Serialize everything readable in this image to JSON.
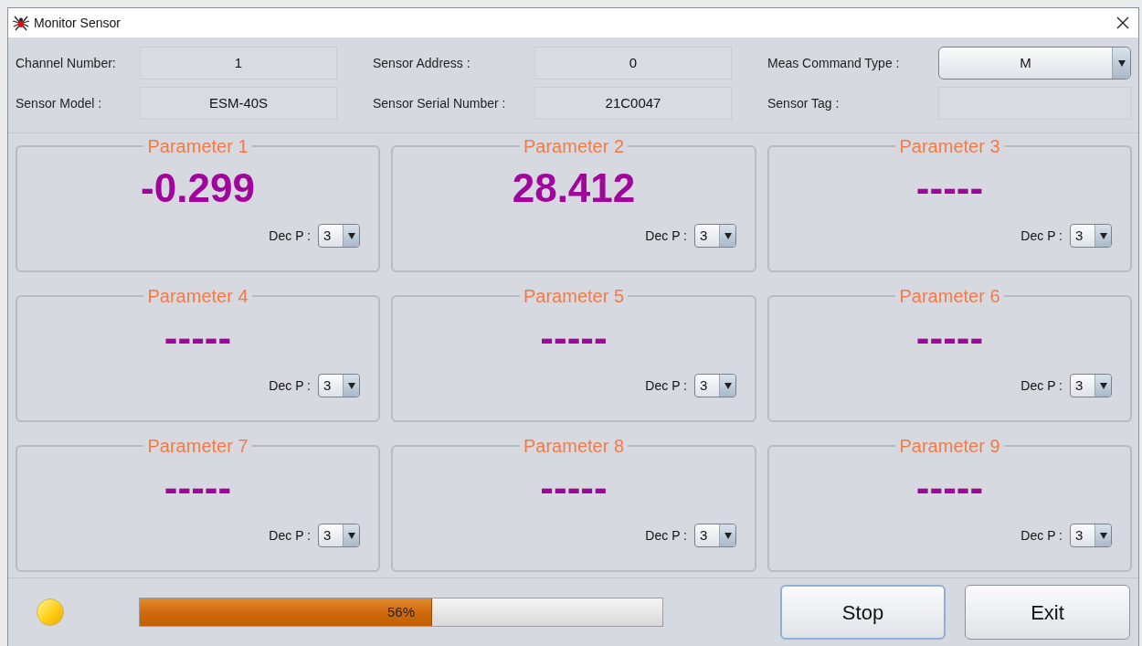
{
  "window": {
    "title": "Monitor Sensor"
  },
  "fields": [
    {
      "label": "Channel Number:",
      "value": "1",
      "kind": "text"
    },
    {
      "label": "Sensor Address :",
      "value": "0",
      "kind": "text"
    },
    {
      "label": "Meas Command Type :",
      "value": "M",
      "kind": "dropdown"
    },
    {
      "label": "Sensor Model :",
      "value": "ESM-40S",
      "kind": "text"
    },
    {
      "label": "Sensor Serial Number :",
      "value": "21C0047",
      "kind": "text"
    },
    {
      "label": "Sensor Tag :",
      "kind": "text"
    }
  ],
  "parameters": [
    {
      "title": "Parameter 1",
      "value": "-0.299",
      "dec_label": "Dec P :",
      "dec": "3"
    },
    {
      "title": "Parameter 2",
      "value": "28.412",
      "dec_label": "Dec P :",
      "dec": "3"
    },
    {
      "title": "Parameter 3",
      "value": "-----",
      "dec_label": "Dec P :",
      "dec": "3"
    },
    {
      "title": "Parameter 4",
      "value": "-----",
      "dec_label": "Dec P :",
      "dec": "3"
    },
    {
      "title": "Parameter 5",
      "value": "-----",
      "dec_label": "Dec P :",
      "dec": "3"
    },
    {
      "title": "Parameter 6",
      "value": "-----",
      "dec_label": "Dec P :",
      "dec": "3"
    },
    {
      "title": "Parameter 7",
      "value": "-----",
      "dec_label": "Dec P :",
      "dec": "3"
    },
    {
      "title": "Parameter 8",
      "value": "-----",
      "dec_label": "Dec P :",
      "dec": "3"
    },
    {
      "title": "Parameter 9",
      "value": "-----",
      "dec_label": "Dec P :",
      "dec": "3"
    }
  ],
  "progress": {
    "level": 0.56,
    "text": "56%"
  },
  "buttons": [
    "Stop",
    "Exit"
  ]
}
